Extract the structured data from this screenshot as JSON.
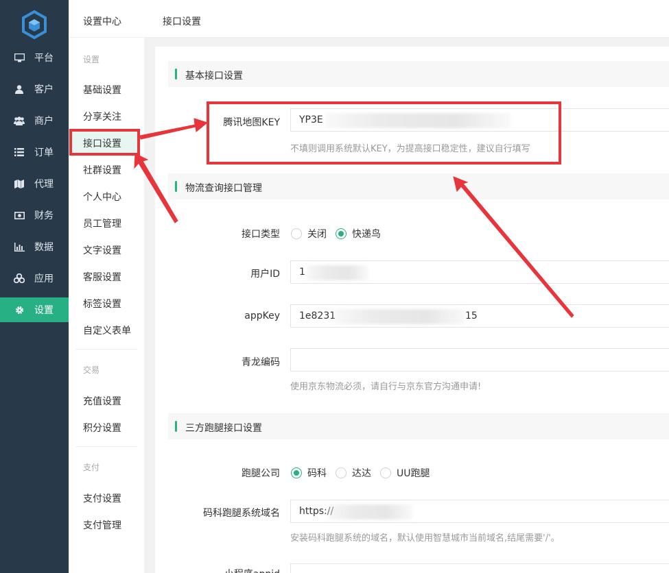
{
  "nav": {
    "items": [
      {
        "label": "平台",
        "icon": "monitor-icon"
      },
      {
        "label": "客户",
        "icon": "user-icon"
      },
      {
        "label": "商户",
        "icon": "users-icon"
      },
      {
        "label": "订单",
        "icon": "list-icon"
      },
      {
        "label": "代理",
        "icon": "map-icon"
      },
      {
        "label": "财务",
        "icon": "money-icon"
      },
      {
        "label": "数据",
        "icon": "bar-chart-icon"
      },
      {
        "label": "应用",
        "icon": "cubes-icon"
      },
      {
        "label": "设置",
        "icon": "gear-icon"
      }
    ]
  },
  "sub": {
    "group1_title": "设置",
    "group1": [
      "基础设置",
      "分享关注",
      "接口设置",
      "社群设置",
      "个人中心",
      "员工管理",
      "文字设置",
      "客服设置",
      "标签设置",
      "自定义表单"
    ],
    "group2_title": "交易",
    "group2": [
      "充值设置",
      "积分设置"
    ],
    "group3_title": "支付",
    "group3": [
      "支付设置",
      "支付管理"
    ]
  },
  "breadcrumb": {
    "root": "设置中心",
    "current": "接口设置"
  },
  "sections": {
    "basic": "基本接口设置",
    "logistics": "物流查询接口管理",
    "errand": "三方跑腿接口设置"
  },
  "form": {
    "map_key_label": "腾讯地图KEY",
    "map_key_value": "YP3E",
    "map_key_hint": "不填则调用系统默认KEY，为提高接口稳定性，建议自行填写",
    "api_type_label": "接口类型",
    "api_type_options": [
      "关闭",
      "快递鸟"
    ],
    "api_type_selected": "快递鸟",
    "user_id_label": "用户ID",
    "user_id_value": "1",
    "appkey_label": "appKey",
    "appkey_value_prefix": "1e8231",
    "appkey_value_suffix": "15",
    "qinglong_label": "青龙编码",
    "qinglong_value": "",
    "qinglong_hint": "使用京东物流必须，请自行与京东官方沟通申请!",
    "errand_company_label": "跑腿公司",
    "errand_options": [
      "码科",
      "达达",
      "UU跑腿"
    ],
    "errand_selected": "码科",
    "domain_label": "码科跑腿系统域名",
    "domain_value": "https://",
    "domain_hint": "安装码科跑腿系统的域名，默认使用智慧城市当前域名,结尾需要'/'。",
    "partial_label": "小程序appid"
  },
  "colors": {
    "sidebar": "#283a4a",
    "accent": "#27b084",
    "annotation": "#e8343b"
  }
}
